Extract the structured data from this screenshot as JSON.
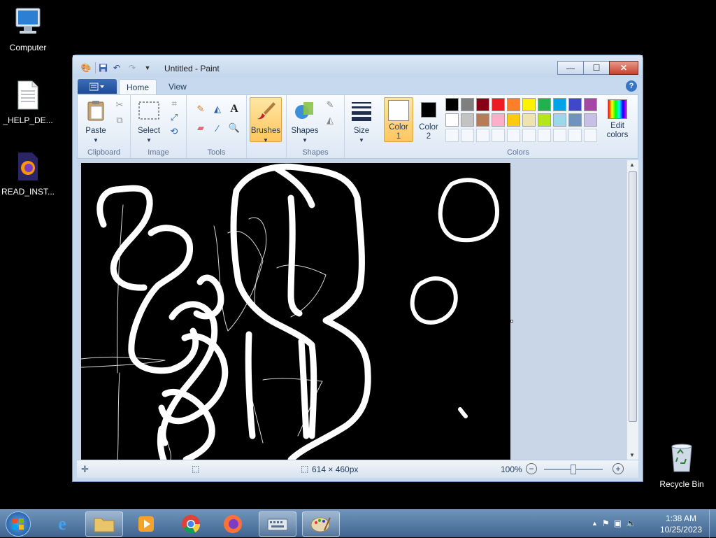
{
  "desktop": {
    "icons": [
      {
        "label": "Computer"
      },
      {
        "label": "_HELP_DE..."
      },
      {
        "label": "READ_INST..."
      },
      {
        "label": "Recycle Bin"
      }
    ]
  },
  "window": {
    "title": "Untitled - Paint",
    "tabs": [
      "Home",
      "View"
    ],
    "controls": {
      "minimize": "—",
      "maximize": "☐",
      "close": "✕"
    }
  },
  "ribbon": {
    "clipboard": {
      "paste": "Paste",
      "group": "Clipboard"
    },
    "image": {
      "select": "Select",
      "group": "Image"
    },
    "tools": {
      "group": "Tools"
    },
    "brushes": {
      "label": "Brushes"
    },
    "shapes": {
      "label": "Shapes",
      "group": "Shapes"
    },
    "size": {
      "label": "Size"
    },
    "color1": {
      "label1": "Color",
      "label2": "1",
      "value": "#ffffff"
    },
    "color2": {
      "label1": "Color",
      "label2": "2",
      "value": "#000000"
    },
    "colors": {
      "group": "Colors",
      "edit1": "Edit",
      "edit2": "colors",
      "row1": [
        "#000000",
        "#7f7f7f",
        "#880015",
        "#ed1c24",
        "#ff7f27",
        "#fff200",
        "#22b14c",
        "#00a2e8",
        "#3f48cc",
        "#a349a4"
      ],
      "row2": [
        "#ffffff",
        "#c3c3c3",
        "#b97a57",
        "#ffaec9",
        "#ffc90e",
        "#efe4b0",
        "#b5e61d",
        "#99d9ea",
        "#7092be",
        "#c8bfe7"
      ]
    }
  },
  "status": {
    "dimensions": "614 × 460px",
    "zoom": "100%",
    "zoom_minus": "−",
    "zoom_plus": "+"
  },
  "taskbar": {
    "time": "1:38 AM",
    "date": "10/25/2023"
  }
}
